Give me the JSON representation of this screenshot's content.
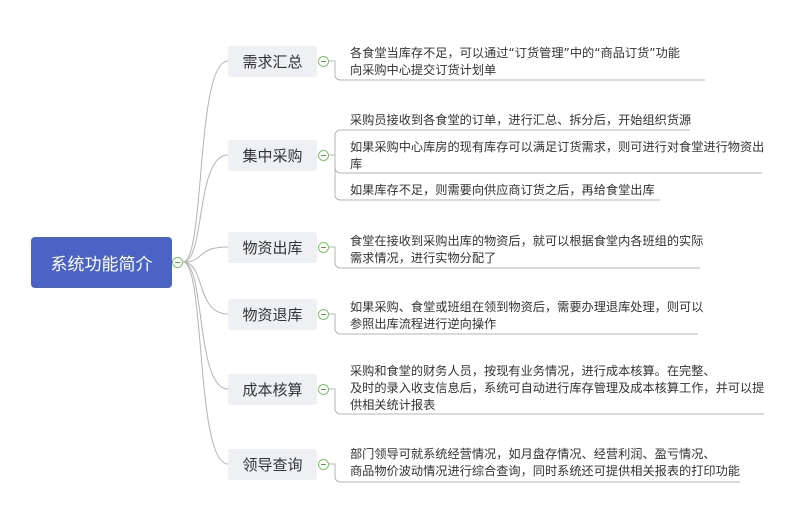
{
  "root": {
    "label": "系统功能简介"
  },
  "branches": [
    {
      "label": "需求汇总",
      "leaves": [
        [
          "各食堂当库存不足，可以通过“订货管理”中的“商品订货”功能",
          "向采购中心提交订货计划单"
        ]
      ]
    },
    {
      "label": "集中采购",
      "leaves": [
        [
          "采购员接收到各食堂的订单，进行汇总、拆分后，开始组织货源"
        ],
        [
          "如果采购中心库房的现有库存可以满足订货需求，则可进行对食堂进行物资出",
          "库"
        ],
        [
          "如果库存不足，则需要向供应商订货之后，再给食堂出库"
        ]
      ]
    },
    {
      "label": "物资出库",
      "leaves": [
        [
          "食堂在接收到采购出库的物资后，就可以根据食堂内各班组的实际",
          "需求情况，进行实物分配了"
        ]
      ]
    },
    {
      "label": "物资退库",
      "leaves": [
        [
          "如果采购、食堂或班组在领到物资后，需要办理退库处理，则可以",
          "参照出库流程进行逆向操作"
        ]
      ]
    },
    {
      "label": "成本核算",
      "leaves": [
        [
          "采购和食堂的财务人员，按现有业务情况，进行成本核算。在完整、",
          "及时的录入收支信息后，系统可自动进行库存管理及成本核算工作，并可以提",
          "供相关统计报表"
        ]
      ]
    },
    {
      "label": "领导查询",
      "leaves": [
        [
          "部门领导可就系统经营情况，如月盘存情况、经营利润、盈亏情况、",
          "商品物价波动情况进行综合查询，同时系统还可提供相关报表的打印功能"
        ]
      ]
    }
  ]
}
